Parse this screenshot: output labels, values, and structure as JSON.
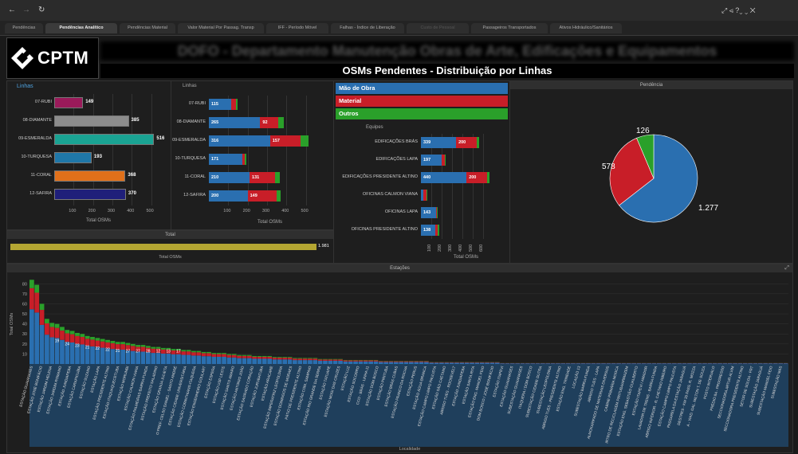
{
  "nav": {
    "back": "←",
    "forward": "→",
    "refresh": "↻",
    "tools": "⤢  ⋖  ?⌄  ⌄  ✕"
  },
  "tabs": [
    "Pendências",
    "Pendências Analítico",
    "Pendências Material",
    "Valor Material Por Passag. Transp",
    "IFF - Período Móvel",
    "Falhas - Índice de Liberação",
    "Custo de Pessoal",
    "Passageiros Transportados",
    "Ativos Hidráulico/Sanitários"
  ],
  "active_tab": 1,
  "logo_text": "CPTM",
  "header_banner": "DOFO - Departamento Manutenção Obras de Arte, Edificações e Equipamentos",
  "page_title": "OSMs Pendentes - Distribuição por Linhas",
  "colors": {
    "mao_de_obra": "#2a6fb0",
    "material": "#c81e28",
    "outros": "#2aa02a",
    "total": "#b4a632"
  },
  "legend": [
    {
      "label": "Mão de Obra",
      "color": "#2a6fb0"
    },
    {
      "label": "Material",
      "color": "#c81e28"
    },
    {
      "label": "Outros",
      "color": "#2aa02a"
    }
  ],
  "linhas_chart": {
    "header": "Linhas",
    "xlabel": "Total OSMs",
    "ticks": [
      "100",
      "200",
      "300",
      "400",
      "500"
    ],
    "rows": [
      {
        "label": "07-RUBI",
        "value": 149,
        "value_label": "149",
        "color": "#9a1a5a"
      },
      {
        "label": "08-DIAMANTE",
        "value": 385,
        "value_label": "385",
        "color": "#8c8c8c"
      },
      {
        "label": "09-ESMERALDA",
        "value": 516,
        "value_label": "516",
        "color": "#1aa393"
      },
      {
        "label": "10-TURQUESA",
        "value": 193,
        "value_label": "193",
        "color": "#1f77a8"
      },
      {
        "label": "11-CORAL",
        "value": 368,
        "value_label": "368",
        "color": "#e0701a"
      },
      {
        "label": "12-SAFIRA",
        "value": 370,
        "value_label": "370",
        "color": "#1f1f7a"
      }
    ]
  },
  "linhas_stacked": {
    "header": "Linhas",
    "xlabel": "Total OSMs",
    "ticks": [
      "100",
      "200",
      "300",
      "400",
      "500"
    ],
    "rows": [
      {
        "label": "07-RUBI",
        "mao": 115,
        "mao_label": "115",
        "mat": 25,
        "mat_label": "",
        "out": 9
      },
      {
        "label": "08-DIAMANTE",
        "mao": 265,
        "mao_label": "265",
        "mat": 92,
        "mat_label": "92",
        "out": 28
      },
      {
        "label": "09-ESMERALDA",
        "mao": 316,
        "mao_label": "316",
        "mat": 157,
        "mat_label": "157",
        "out": 43
      },
      {
        "label": "10-TURQUESA",
        "mao": 171,
        "mao_label": "171",
        "mat": 16,
        "mat_label": "",
        "out": 6
      },
      {
        "label": "11-CORAL",
        "mao": 210,
        "mao_label": "210",
        "mat": 131,
        "mat_label": "131",
        "out": 27
      },
      {
        "label": "12-SAFIRA",
        "mao": 200,
        "mao_label": "200",
        "mat": 149,
        "mat_label": "149",
        "out": 21
      }
    ]
  },
  "equipes_chart": {
    "header": "Equipes",
    "xlabel": "Total OSMs",
    "ticks": [
      "100",
      "200",
      "300",
      "400",
      "500",
      "600"
    ],
    "rows": [
      {
        "label": "EDIFICAÇÕES BRÁS",
        "mao": 339,
        "mao_label": "339",
        "mat": 200,
        "mat_label": "200",
        "out": 22
      },
      {
        "label": "EDIFICAÇÕES LAPA",
        "mao": 197,
        "mao_label": "197",
        "mat": 30,
        "mat_label": "",
        "out": 8
      },
      {
        "label": "EDIFICAÇÕES PRESIDENTE ALTINO",
        "mao": 440,
        "mao_label": "440",
        "mat": 200,
        "mat_label": "200",
        "out": 25
      },
      {
        "label": "OFICINAS CALMON VIANA",
        "mao": 20,
        "mao_label": "",
        "mat": 35,
        "mat_label": "",
        "out": 8
      },
      {
        "label": "OFICINAS LAPA",
        "mao": 143,
        "mao_label": "143",
        "mat": 12,
        "mat_label": "",
        "out": 5
      },
      {
        "label": "OFICINAS PRESIDENTE ALTINO",
        "mao": 138,
        "mao_label": "138",
        "mat": 25,
        "mat_label": "",
        "out": 12
      }
    ]
  },
  "pendencia_pie": {
    "header": "Pendência",
    "slices": [
      {
        "name": "Mão de Obra",
        "value": 1277,
        "label": "1.277",
        "color": "#2a6fb0"
      },
      {
        "name": "Material",
        "value": 578,
        "label": "578",
        "color": "#c81e28"
      },
      {
        "name": "Outros",
        "value": 126,
        "label": "126",
        "color": "#2aa02a"
      }
    ]
  },
  "total_panel": {
    "header": "Total",
    "value": 1981,
    "value_label": "1.981",
    "xlabel": "Total OSMs"
  },
  "estacoes": {
    "header": "Estações",
    "ylabel": "Total OSMs",
    "xlabel": "Localidade",
    "yticks": [
      "10",
      "20",
      "30",
      "40",
      "50",
      "60",
      "70",
      "80"
    ],
    "ymax": 85,
    "bar_count": 150,
    "top_totals": [
      84,
      79,
      60,
      45,
      41,
      40,
      37,
      34,
      33,
      31,
      30,
      28,
      27,
      26,
      25,
      24,
      23,
      22,
      22,
      21
    ],
    "inline_labels": [
      "19",
      "24",
      "23",
      "21",
      "22",
      "22",
      "21",
      "27",
      "27",
      "28",
      "12",
      "13",
      "17"
    ],
    "station_labels": [
      "ESTAÇÃO GUAIANASES",
      "ESTAÇÃO JOSÉ BONIFÁCIO",
      "ESTAÇÃO JARDIM HELENA",
      "ESTAÇÃO JARDIM ROMANO",
      "ESTAÇÃO JUNDIAPEBA",
      "ESTAÇÃO CARAPICUÍBA",
      "ESTAÇÃO SUZANO",
      "ESTAÇÃO LAPA",
      "ESTAÇÃO PRESIDENTE ALTINO",
      "ESTAÇÃO ITAQUAQUECETUBA",
      "ESTAÇÃO MORUMBI",
      "ESTAÇÃO CALMON VIANA",
      "ESTAÇÃO PALMEIRAS-BARRA FUNDA",
      "ESTAÇÃO PREFEITO SALADINO",
      "ESTAÇÃO GRANJA JULIETA",
      "O PREF. CELSO DANIEL - SANTO ANDRÉ",
      "ESTAÇÃO CIDADE UNIVERSITÁRIA",
      "ESTAÇÃO CORINTHIANS-ITAQUERA",
      "ESTAÇÃO ENGENHEIRO GOULART",
      "ESTAÇÃO ESPERA",
      "ESTAÇÃO USP LESTE",
      "ESTAÇÃO SANTO AMARO",
      "ESTAÇÃO ANTONIO JOÃO",
      "ESTAÇÃO SAGRADO CORAÇÃO",
      "ESTAÇÃO JURUBATUBA",
      "ESTAÇÃO ARACARÉ",
      "ESTAÇÃO IMPERATRIZ LEOPOLDINA",
      "ESTAÇÃO DOMINGOS DE MORAES",
      "PÁTIO DE PRESIDENTE ALTINO",
      "ESTAÇÃO COM. SAMPAIO",
      "ESTAÇÃO RIO GRANDE DA SERRA",
      "ESTAÇÃO TATUAPÉ",
      "ESTAÇÃO MOGI DAS CRUZES",
      "ESTAÇÃO LUZ",
      "ESTAÇÃO SOCORRO",
      "CCO - BRÁS - LINHA 11",
      "ESTAÇÃO DOM BOSCO",
      "ESTAÇÃO PIRITUBA",
      "ESTAÇÃO BRÁS CUBAS",
      "ESTAÇÃO FRANCO DA ROCHA",
      "ESTAÇÃO PERUS",
      "ESTAÇÃO ÁGUA BRANCA",
      "ESTAÇÃO CAMPO LIMPO PAULISTA",
      "ESTAÇÃO SÃO CAETANO",
      "ABRIGO TUES - ROOSEVELT",
      "ESTAÇÃO JUNDIAPEBA",
      "ESTAÇÃO SANTA RITA",
      "ESTAÇÃO ENG. MANOEL FEIO",
      "DOM BOSCO / JOSÉ BONIFÁCIO",
      "ESTAÇÃO ITAPEVI",
      "ESTAÇÃO GUAIANASES",
      "SUBESTAÇÃO GUAIANASES",
      "ITAQUERA / DOM BOSCO",
      "SUBESTAÇÃO CIDADE DUTRA",
      "SUBESTAÇÃO LEOPOLDINA",
      "ABRIGO TUES - PRESIDENTE ALTINO",
      "ESTAÇÃO ENG. TRINDADE",
      "LOCAÇÃO 13",
      "SUBESTAÇÃO BARRA FUNDA",
      "ABRIGO TUES - LAPA",
      "ALMOXARIFADO DE MATERIAIS DIVERSOS",
      "CABINE PRIMÁRIA MOOCA",
      "IRTRO DE RECICLAGEM PIRITUBA/ARMAZEM",
      "ESTAÇÃO ENG. SEBASTIÃO GUALBERTO",
      "ESTAÇÃO ITAPEVI / AMADOR",
      "LAVADOR DE TRENS - BARRA FUNDA",
      "ABRIGO INFERIOR - R. CAETANO RIBEIRO",
      "ESTAÇÃO CAMPO LIMPO PAULISTA",
      "PASSARELA DA ESTAÇÃO JARAGUÁ",
      "DESTRES - KM 39 PASS. R. MOZZA",
      "A - VIAD. GAL. MILTON T. DE SOUZA",
      "POSTO INTERVALO",
      "PRÉDIO 8A - PROGRESSO",
      "SECCIONADORA ARTUR ALVIM",
      "SECCIONADORA PRESIDENTE ALTINO",
      "SETOR DE SOLDA - FRT",
      "SUBESTAÇÃO JARAGUÁ",
      "SUBESTAÇÃO MANOEL FEIO",
      "SUBESTAÇÃO MÁS"
    ]
  }
}
